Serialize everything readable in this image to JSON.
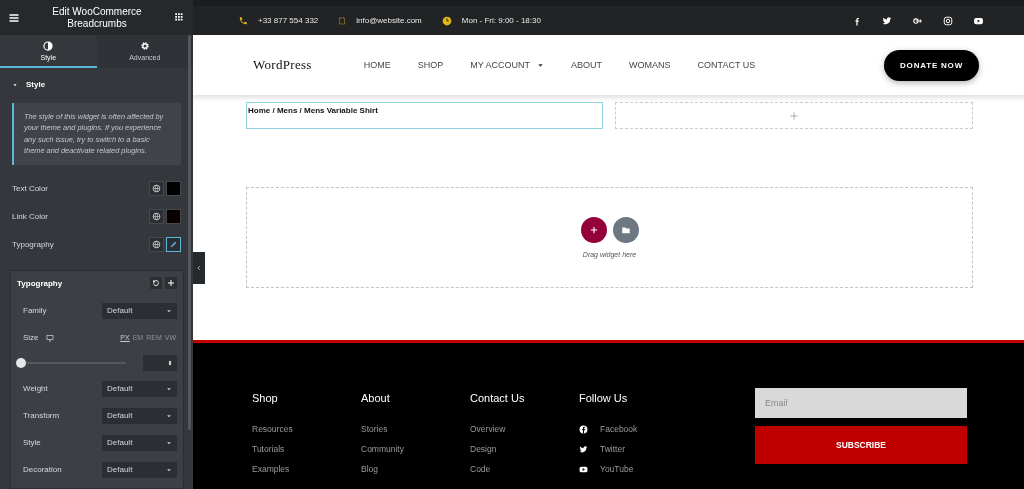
{
  "panel": {
    "title": "Edit WooCommerce Breadcrumbs",
    "tabs": [
      {
        "label": "Style",
        "kind": "contrast",
        "selected": true
      },
      {
        "label": "Advanced",
        "kind": "gear",
        "selected": false
      }
    ],
    "section": {
      "title": "Style",
      "expanded": true
    },
    "notice": "The style of this widget is often affected by your theme and plugins. If you experience any such issue, try to switch to a basic theme and deactivate related plugins.",
    "controls": [
      {
        "label": "Text Color",
        "kind": "color",
        "color": "#000000"
      },
      {
        "label": "Link Color",
        "kind": "color",
        "color": "#0a0000"
      },
      {
        "label": "Typography",
        "kind": "edit",
        "active": true
      }
    ],
    "popover": {
      "title": "Typography",
      "fields": [
        {
          "label": "Family",
          "kind": "select",
          "value": "Default"
        },
        {
          "label": "Size",
          "kind": "slider",
          "level": 0,
          "units": [
            {
              "label": "PX",
              "selected": true
            },
            {
              "label": "EM",
              "selected": false
            },
            {
              "label": "REM",
              "selected": false
            },
            {
              "label": "VW",
              "selected": false
            }
          ]
        },
        {
          "label": "Weight",
          "kind": "select",
          "value": "Default"
        },
        {
          "label": "Transform",
          "kind": "select",
          "value": "Default"
        },
        {
          "label": "Style",
          "kind": "select",
          "value": "Default"
        },
        {
          "label": "Decoration",
          "kind": "select",
          "value": "Default"
        }
      ]
    }
  },
  "site": {
    "topbar": [
      {
        "kind": "phone",
        "text": "+33 877 554 332"
      },
      {
        "kind": "email",
        "text": "info@website.com"
      },
      {
        "kind": "clock",
        "text": "Mon - Fri: 9:00 - 18:30"
      }
    ],
    "logo": "WordPress",
    "nav": [
      {
        "label": "HOME",
        "dropdown": false
      },
      {
        "label": "SHOP",
        "dropdown": false
      },
      {
        "label": "MY ACCOUNT",
        "dropdown": true
      },
      {
        "label": "ABOUT",
        "dropdown": false
      },
      {
        "label": "WOMANS",
        "dropdown": false
      },
      {
        "label": "CONTACT US",
        "dropdown": false
      }
    ],
    "cta": "DONATE NOW",
    "breadcrumb": "Home / Mens / Mens Variable Shirt",
    "drop_hint": "Drag widget here",
    "footer": [
      {
        "title": "Shop",
        "links": [
          {
            "label": "Resources"
          },
          {
            "label": "Tutorials"
          },
          {
            "label": "Examples"
          }
        ]
      },
      {
        "title": "About",
        "links": [
          {
            "label": "Stories"
          },
          {
            "label": "Community"
          },
          {
            "label": "Blog"
          }
        ]
      },
      {
        "title": "Contact Us",
        "links": [
          {
            "label": "Overview"
          },
          {
            "label": "Design"
          },
          {
            "label": "Code"
          }
        ]
      },
      {
        "title": "Follow Us",
        "links": [
          {
            "label": "Facebook",
            "kind": "facebook"
          },
          {
            "label": "Twitter",
            "kind": "twitter"
          },
          {
            "label": "YouTube",
            "kind": "youtube"
          }
        ]
      }
    ],
    "email_placeholder": "Email",
    "subscribe": "SUBSCRIBE"
  }
}
